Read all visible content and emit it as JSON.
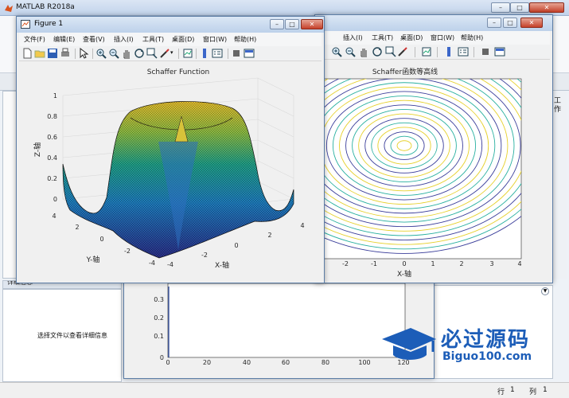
{
  "app": {
    "title": "MATLAB R2018a"
  },
  "figure1": {
    "title": "Figure 1",
    "menus": [
      "文件(F)",
      "编辑(E)",
      "查看(V)",
      "插入(I)",
      "工具(T)",
      "桌面(D)",
      "窗口(W)",
      "帮助(H)"
    ],
    "plot": {
      "title": "Schaffer Function",
      "zlabel": "Z-轴",
      "ylabel": "Y-轴",
      "xlabel": "X-轴",
      "z_ticks": [
        "0",
        "0.2",
        "0.4",
        "0.6",
        "0.8",
        "1"
      ],
      "y_ticks": [
        "4",
        "2",
        "0",
        "-2",
        "-4"
      ],
      "x_ticks": [
        "-4",
        "-2",
        "0",
        "2",
        "4"
      ]
    }
  },
  "figure2": {
    "menus": [
      "插入(I)",
      "工具(T)",
      "桌面(D)",
      "窗口(W)",
      "帮助(H)"
    ],
    "plot": {
      "title": "Schaffer函数等高线",
      "xlabel": "X-轴",
      "x_ticks": [
        "-2",
        "-1",
        "0",
        "1",
        "2",
        "3",
        "4"
      ]
    }
  },
  "figure3": {
    "y_ticks": [
      "0.3",
      "0.2",
      "0.1",
      "0"
    ],
    "x_ticks": [
      "0",
      "20",
      "40",
      "60",
      "80",
      "100",
      "120"
    ]
  },
  "side": {
    "workspace_tab": "工作",
    "details_header": "详细信息",
    "details_hint": "选择文件以查看详细信息"
  },
  "statusbar": {
    "row_label": "行",
    "row_value": "1",
    "col_label": "列",
    "col_value": "1"
  },
  "watermark": {
    "cn": "必过源码",
    "en": "Biguo100.com"
  },
  "colors": {
    "surface_low": "#2b2f8a",
    "surface_mid": "#21a38a",
    "surface_high": "#e8c12e",
    "contour_blue": "#3a3d9a",
    "contour_teal": "#29b0a0",
    "contour_yellow": "#e6d02a"
  }
}
